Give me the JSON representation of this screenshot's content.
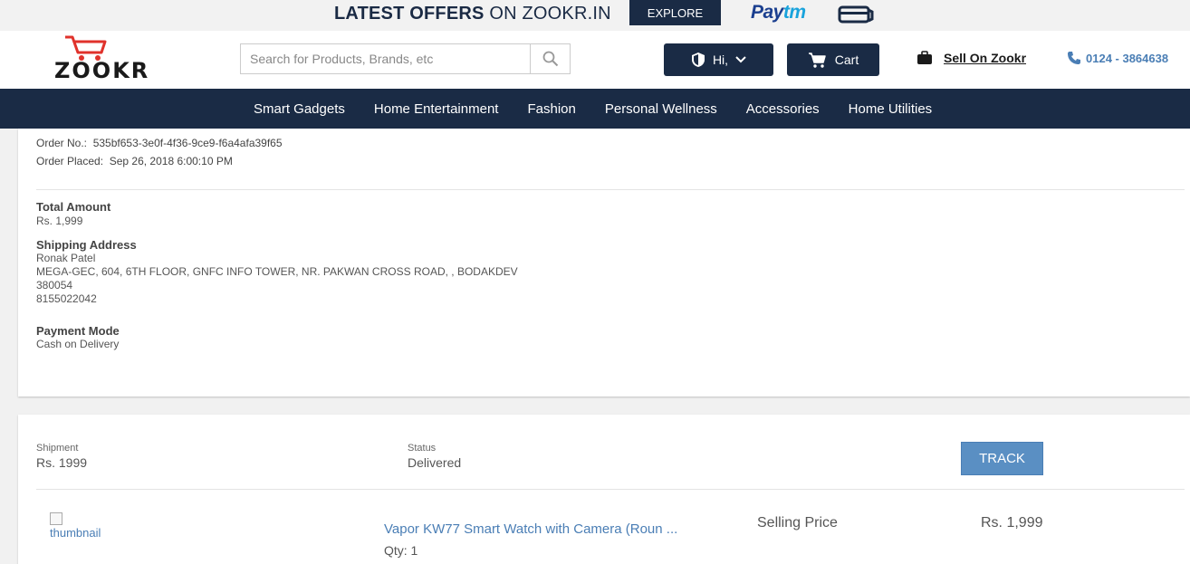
{
  "offer_bar": {
    "text_bold": "LATEST OFFERS",
    "text_rest": " ON ZOOKR.IN",
    "explore_label": "EXPLORE",
    "paytm_pay": "Pay",
    "paytm_tm": "tm"
  },
  "header": {
    "logo_text": "ZOOKR",
    "search_placeholder": "Search for Products, Brands, etc",
    "greeting": "Hi,",
    "cart_label": "Cart",
    "sell_label": "Sell On Zookr",
    "phone": "0124 - 3864638"
  },
  "nav": {
    "items": [
      "Smart Gadgets",
      "Home Entertainment",
      "Fashion",
      "Personal Wellness",
      "Accessories",
      "Home Utilities"
    ]
  },
  "order": {
    "order_no_label": "Order No.:",
    "order_no": "535bf653-3e0f-4f36-9ce9-f6a4afa39f65",
    "placed_label": "Order Placed:",
    "placed": "Sep 26, 2018 6:00:10 PM",
    "total_label": "Total Amount",
    "total": "Rs. 1,999",
    "shipping_label": "Shipping Address",
    "ship_name": "Ronak Patel",
    "ship_line1": "MEGA-GEC, 604, 6TH FLOOR, GNFC INFO TOWER, NR. PAKWAN CROSS ROAD, , BODAKDEV",
    "ship_zip": "380054",
    "ship_phone": "8155022042",
    "payment_label": "Payment Mode",
    "payment": "Cash on Delivery"
  },
  "shipment": {
    "shipment_label": "Shipment",
    "shipment_value": "Rs. 1999",
    "status_label": "Status",
    "status_value": "Delivered",
    "track_label": "TRACK",
    "thumb_alt": "thumbnail",
    "product_name": "Vapor KW77 Smart Watch with Camera (Roun ...",
    "qty": "Qty: 1",
    "selling_price_label": "Selling Price",
    "selling_price": "Rs. 1,999"
  },
  "colors": {
    "navy": "#1a2b45",
    "accent_blue": "#4a7eb5",
    "track_blue": "#5a8fc3"
  }
}
